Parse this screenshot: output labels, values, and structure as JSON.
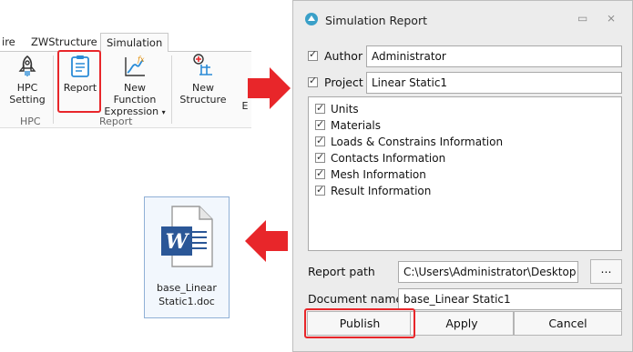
{
  "ribbon": {
    "tabs": [
      "ire",
      "ZWStructure",
      "Simulation"
    ],
    "buttons": {
      "hpc_setting": "HPC\nSetting",
      "report": "Report",
      "new_function_line1": "New Function",
      "new_function_line2": "Expression",
      "new_structure_line1": "New",
      "new_structure_line2": "Structure",
      "cut_letter": "E"
    },
    "groups": {
      "hpc": "HPC",
      "report": "Report"
    }
  },
  "document": {
    "name_line1": "base_Linear",
    "name_line2": "Static1.doc"
  },
  "dialog": {
    "title": "Simulation Report",
    "author_label": "Author",
    "author_value": "Administrator",
    "project_label": "Project",
    "project_value": "Linear Static1",
    "sections": [
      "Units",
      "Materials",
      "Loads & Constrains Information",
      "Contacts Information",
      "Mesh Information",
      "Result Information"
    ],
    "report_path_label": "Report path",
    "report_path_value": "C:\\Users\\Administrator\\Desktop",
    "browse_label": "...",
    "document_name_label": "Document name",
    "document_name_value": "base_Linear Static1",
    "buttons": {
      "publish": "Publish",
      "apply": "Apply",
      "cancel": "Cancel"
    }
  },
  "colors": {
    "highlight": "#e8262a",
    "arrow": "#e8262a",
    "word_blue": "#2b5797"
  }
}
